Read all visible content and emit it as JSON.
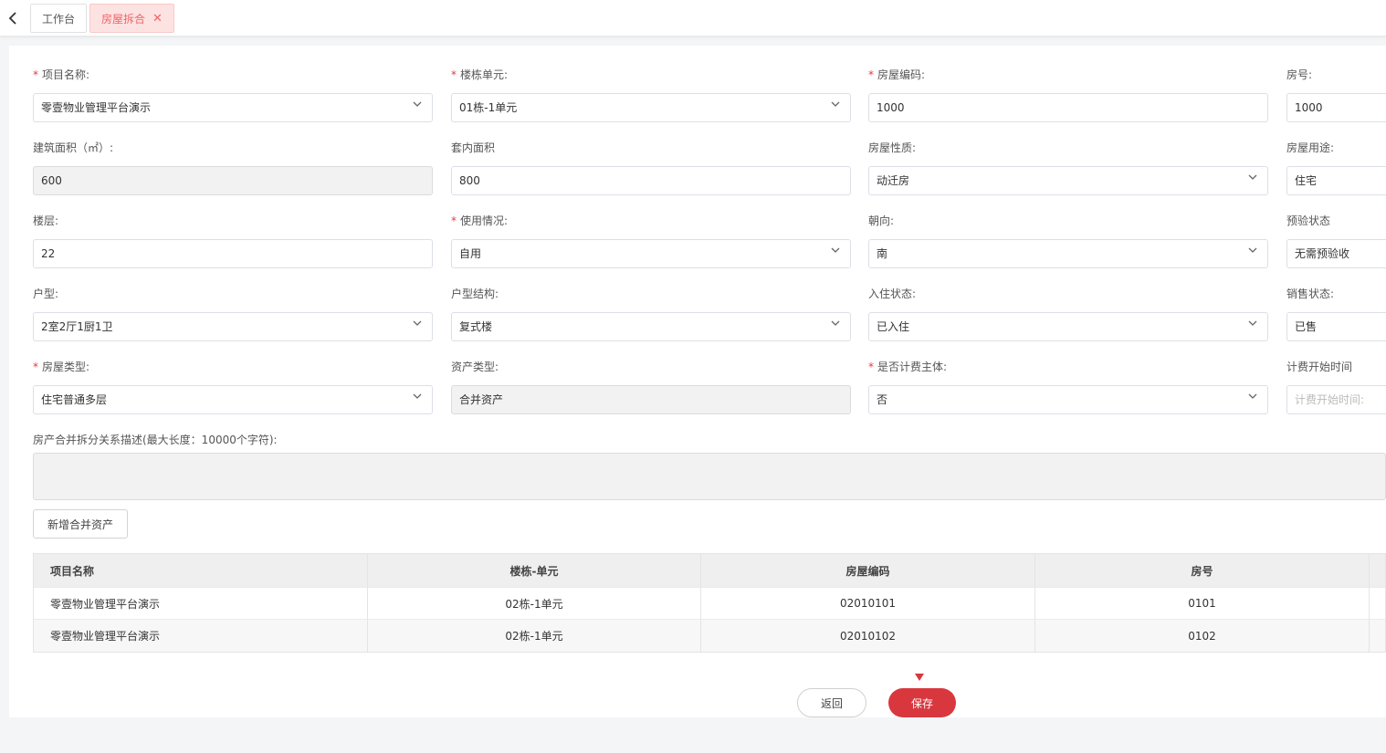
{
  "colors": {
    "accent": "#d9373e",
    "required": "#e63b3b",
    "active_tab_bg": "#fde2e2"
  },
  "tabs": [
    {
      "label": "工作台"
    },
    {
      "label": "房屋拆合",
      "close": "✕"
    }
  ],
  "form": {
    "project_name": {
      "label": "项目名称:",
      "value": "零壹物业管理平台演示",
      "required": "*"
    },
    "building_unit": {
      "label": "楼栋单元:",
      "value": "01栋-1单元",
      "required": "*"
    },
    "house_code": {
      "label": "房屋编码:",
      "value": "1000",
      "required": "*"
    },
    "room_no": {
      "label": "房号:",
      "value": "1000"
    },
    "building_area": {
      "label": "建筑面积（㎡）:",
      "value": "600"
    },
    "inner_area": {
      "label": "套内面积",
      "value": "800"
    },
    "house_nature": {
      "label": "房屋性质:",
      "value": "动迁房"
    },
    "house_usage": {
      "label": "房屋用途:",
      "value": "住宅"
    },
    "floor": {
      "label": "楼层:",
      "value": "22"
    },
    "usage_status": {
      "label": "使用情况:",
      "value": "自用",
      "required": "*"
    },
    "orientation": {
      "label": "朝向:",
      "value": "南"
    },
    "pre_check": {
      "label": "预验状态",
      "value": "无需预验收"
    },
    "layout": {
      "label": "户型:",
      "value": "2室2厅1厨1卫"
    },
    "layout_structure": {
      "label": "户型结构:",
      "value": "复式楼"
    },
    "occupancy": {
      "label": "入住状态:",
      "value": "已入住"
    },
    "sale_status": {
      "label": "销售状态:",
      "value": "已售"
    },
    "house_type": {
      "label": "房屋类型:",
      "value": "住宅普通多层",
      "required": "*"
    },
    "asset_type": {
      "label": "资产类型:",
      "value": "合并资产"
    },
    "billing_subject": {
      "label": "是否计费主体:",
      "value": "否",
      "required": "*"
    },
    "billing_start": {
      "label": "计费开始时间",
      "placeholder": "计费开始时间:"
    },
    "description": {
      "label": "房产合并拆分关系描述(最大长度：10000个字符):"
    }
  },
  "add_button": "新增合并资产",
  "table": {
    "headers": [
      "项目名称",
      "楼栋-单元",
      "房屋编码",
      "房号"
    ],
    "rows": [
      [
        "零壹物业管理平台演示",
        "02栋-1单元",
        "02010101",
        "0101"
      ],
      [
        "零壹物业管理平台演示",
        "02栋-1单元",
        "02010102",
        "0102"
      ]
    ]
  },
  "buttons": {
    "return": "返回",
    "save": "保存"
  }
}
